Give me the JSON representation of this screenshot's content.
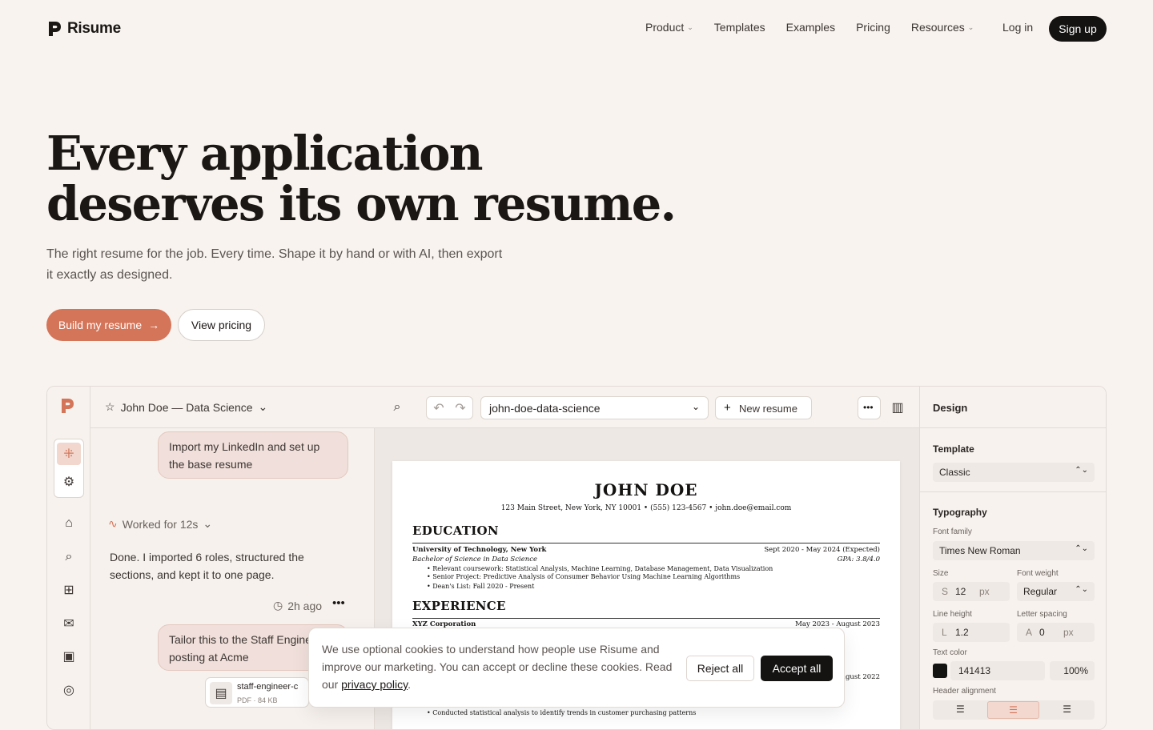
{
  "nav": {
    "brand": "Risume",
    "links": [
      "Product",
      "Templates",
      "Examples",
      "Pricing",
      "Resources"
    ],
    "login": "Log in",
    "signup": "Sign up"
  },
  "hero": {
    "title_line1": "Every application",
    "title_line2": "deserves its own resume.",
    "subtitle": "The right resume for the job. Every time. Shape it by hand or with AI, then export it exactly as designed.",
    "primary_cta": "Build my resume",
    "secondary_cta": "View pricing"
  },
  "app": {
    "chat_title": "John Doe — Data Science",
    "messages": {
      "user1": "Import my LinkedIn and set up the base resume",
      "worked": "Worked for 12s",
      "assistant": "Done. I imported 6 roles, structured the sections, and kept it to one page.",
      "time": "2h ago",
      "user2": "Tailor this to the Staff Engineer posting at Acme",
      "file_name": "staff-engineer-c",
      "file_meta": "PDF · 84 KB"
    },
    "editor": {
      "resume_select": "john-doe-data-science",
      "new_resume": "New resume"
    },
    "resume": {
      "name": "JOHN DOE",
      "contact": "123 Main Street, New York, NY 10001  •  (555) 123-4567  •  john.doe@email.com",
      "education_title": "EDUCATION",
      "school": "University of Technology, New York",
      "school_dates": "Sept 2020 - May 2024 (Expected)",
      "degree": "Bachelor of Science in Data Science",
      "gpa": "GPA: 3.8/4.0",
      "bullets": [
        "Relevant coursework: Statistical Analysis, Machine Learning, Database Management, Data Visualization",
        "Senior Project: Predictive Analysis of Consumer Behavior Using Machine Learning Algorithms",
        "Dean's List: Fall 2020 - Present"
      ],
      "experience_title": "EXPERIENCE",
      "company": "XYZ Corporation",
      "company_dates": "May 2023 - August 2023",
      "second_date": "ugust 2022",
      "experience_bullet": "Conducted statistical analysis to identify trends in customer purchasing patterns"
    },
    "design": {
      "panel_title": "Design",
      "template_label": "Template",
      "template_value": "Classic",
      "typography_label": "Typography",
      "font_family_label": "Font family",
      "font_family_value": "Times New Roman",
      "size_label": "Size",
      "size_prefix": "S",
      "size_value": "12",
      "size_unit": "px",
      "weight_label": "Font weight",
      "weight_value": "Regular",
      "line_height_label": "Line height",
      "line_height_prefix": "L",
      "line_height_value": "1.2",
      "letter_spacing_label": "Letter spacing",
      "letter_spacing_prefix": "A",
      "letter_spacing_value": "0",
      "letter_spacing_unit": "px",
      "text_color_label": "Text color",
      "text_color_value": "141413",
      "text_color_opacity": "100%",
      "header_alignment_label": "Header alignment"
    }
  },
  "cookie": {
    "text": "We use optional cookies to understand how people use Risume and improve our marketing. You can accept or decline these cookies. Read our",
    "link": "privacy policy",
    "suffix": ".",
    "reject": "Reject all",
    "accept": "Accept all"
  },
  "colors": {
    "accent": "#d47458",
    "dark": "#151312",
    "text_color_swatch": "#141413"
  },
  "icons": [
    "logo-icon",
    "chevron-down-icon",
    "arrow-right-icon",
    "star-icon",
    "home-icon",
    "search-icon",
    "grid-icon",
    "mail-icon",
    "briefcase-icon",
    "globe-icon",
    "pulse-icon",
    "clock-icon",
    "more-icon",
    "undo-icon",
    "redo-icon",
    "plus-icon",
    "sidebar-icon",
    "file-icon"
  ]
}
